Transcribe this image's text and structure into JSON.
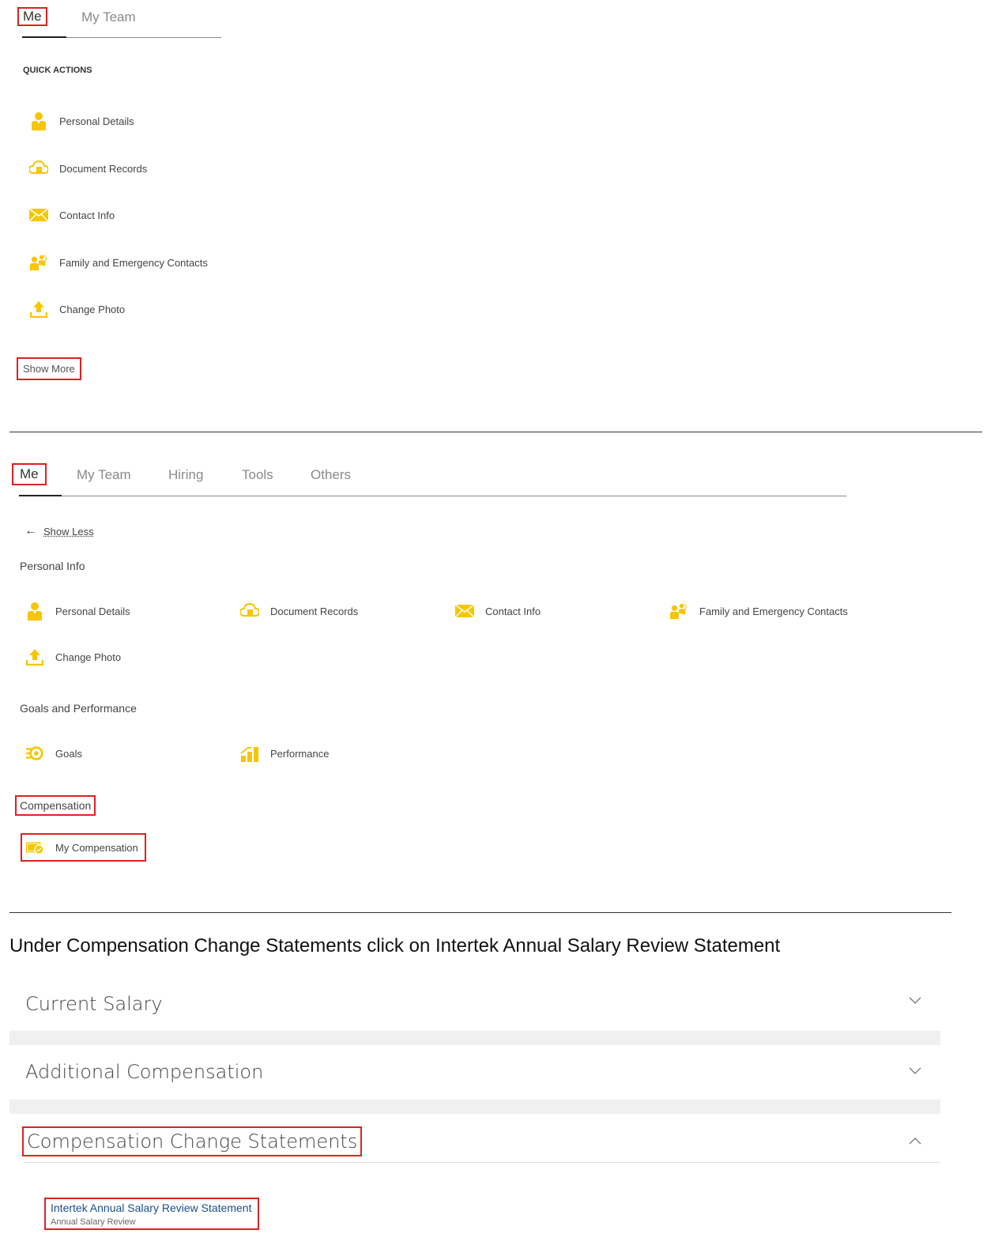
{
  "top": {
    "tabs": [
      "Me",
      "My Team"
    ],
    "section_label": "QUICK ACTIONS",
    "actions": [
      "Personal Details",
      "Document Records",
      "Contact Info",
      "Family and Emergency Contacts",
      "Change Photo"
    ],
    "show_more": "Show More"
  },
  "middle": {
    "tabs": [
      "Me",
      "My Team",
      "Hiring",
      "Tools",
      "Others"
    ],
    "show_less": "Show Less",
    "personal_info": {
      "title": "Personal Info",
      "items": [
        "Personal Details",
        "Document Records",
        "Contact Info",
        "Family and Emergency Contacts",
        "Change Photo"
      ]
    },
    "goals_perf": {
      "title": "Goals and Performance",
      "items": [
        "Goals",
        "Performance"
      ]
    },
    "compensation": {
      "title": "Compensation",
      "items": [
        "My Compensation"
      ]
    }
  },
  "instruction": "Under Compensation Change Statements click on Intertek Annual Salary Review Statement",
  "accordion": {
    "sections": [
      "Current Salary",
      "Additional Compensation",
      "Compensation Change Statements"
    ],
    "statement_link": "Intertek Annual Salary Review Statement",
    "statement_sub": "Annual Salary Review"
  },
  "colors": {
    "icon_yellow": "#f7c600",
    "highlight_red": "#e02020",
    "link_blue": "#1a4f8a"
  }
}
